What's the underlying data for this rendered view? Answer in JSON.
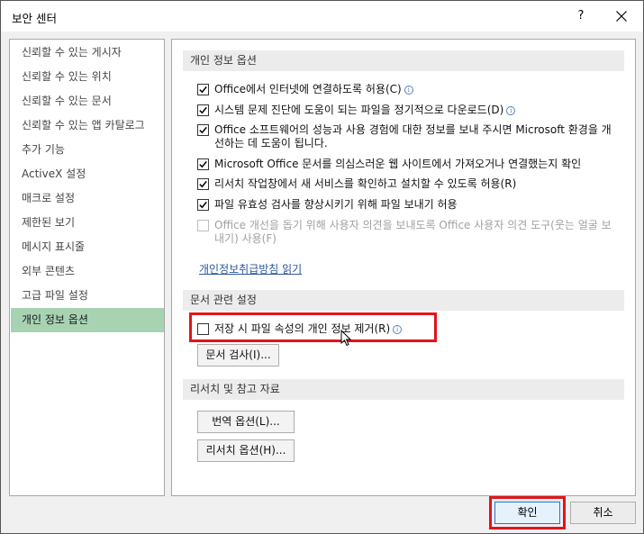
{
  "window": {
    "title": "보안 센터",
    "help_label": "?"
  },
  "sidebar": {
    "items": [
      {
        "label": "신뢰할 수 있는 게시자"
      },
      {
        "label": "신뢰할 수 있는 위치"
      },
      {
        "label": "신뢰할 수 있는 문서"
      },
      {
        "label": "신뢰할 수 있는 앱 카탈로그"
      },
      {
        "label": "추가 기능"
      },
      {
        "label": "ActiveX 설정"
      },
      {
        "label": "매크로 설정"
      },
      {
        "label": "제한된 보기"
      },
      {
        "label": "메시지 표시줄"
      },
      {
        "label": "외부 콘텐츠"
      },
      {
        "label": "고급 파일 설정"
      },
      {
        "label": "개인 정보 옵션",
        "selected": true
      }
    ]
  },
  "privacy": {
    "header": "개인 정보 옵션",
    "options": [
      {
        "label": "Office에서 인터넷에 연결하도록 허용(C)",
        "checked": true,
        "enabled": true,
        "info": true
      },
      {
        "label": "시스템 문제 진단에 도움이 되는 파일을 정기적으로 다운로드(D)",
        "checked": true,
        "enabled": true,
        "info": true
      },
      {
        "label": "Office 소프트웨어의 성능과 사용 경험에 대한 정보를 보내 주시면 Microsoft 환경을 개선하는 데 도움이 됩니다.",
        "checked": true,
        "enabled": true,
        "info": false
      },
      {
        "label": "Microsoft Office 문서를 의심스러운 웹 사이트에서 가져오거나 연결했는지 확인",
        "checked": true,
        "enabled": true,
        "info": false
      },
      {
        "label": "리서치 작업창에서 새 서비스를 확인하고 설치할 수 있도록 허용(R)",
        "checked": true,
        "enabled": true,
        "info": false
      },
      {
        "label": "파일 유효성 검사를 향상시키기 위해 파일 보내기 허용",
        "checked": true,
        "enabled": true,
        "info": false
      },
      {
        "label": "Office 개선을 돕기 위해 사용자 의견을 보내도록 Office 사용자 의견 도구(웃는 얼굴 보내기) 사용(F)",
        "checked": false,
        "enabled": false,
        "info": false
      }
    ],
    "policy_link": "개인정보취급방침 읽기"
  },
  "document": {
    "header": "문서 관련 설정",
    "remove_personal_info": {
      "label": "저장 시 파일 속성의 개인 정보 제거(R)",
      "checked": false,
      "info": true
    },
    "inspect_button": "문서 검사(I)..."
  },
  "research": {
    "header": "리서치 및 참고 자료",
    "translation_button": "번역 옵션(L)...",
    "research_button": "리서치 옵션(H)..."
  },
  "footer": {
    "ok_label": "확인",
    "cancel_label": "취소"
  },
  "colors": {
    "selected_item": "#a7d3b3",
    "highlight": "#e1141b",
    "link": "#2b579a",
    "ok_border": "#2a6fd6"
  },
  "icons": [
    "close-icon",
    "check-icon",
    "info-icon",
    "mouse-cursor-icon"
  ]
}
